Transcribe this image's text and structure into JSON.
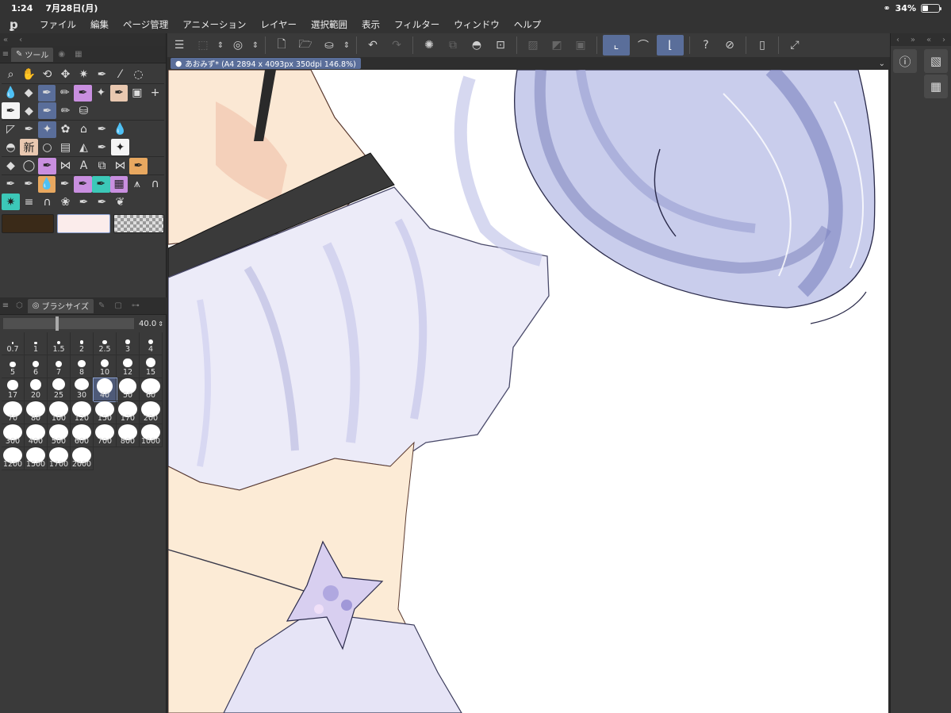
{
  "status_bar": {
    "time": "1:24",
    "date": "7月28日(月)",
    "battery": "34%",
    "battery_level": 0.34
  },
  "menubar": {
    "items": [
      "ファイル",
      "編集",
      "ページ管理",
      "アニメーション",
      "レイヤー",
      "選択範囲",
      "表示",
      "フィルター",
      "ウィンドウ",
      "ヘルプ"
    ]
  },
  "tool_panel": {
    "tab_label": "ツール"
  },
  "brush_panel": {
    "tab_label": "ブラシサイズ",
    "current_value": "40.0",
    "slider_level": 0.4,
    "selected": "40",
    "sizes": [
      "0.7",
      "1",
      "1.5",
      "2",
      "2.5",
      "3",
      "4",
      "5",
      "6",
      "7",
      "8",
      "10",
      "12",
      "15",
      "17",
      "20",
      "25",
      "30",
      "40",
      "50",
      "60",
      "70",
      "80",
      "100",
      "120",
      "150",
      "170",
      "200",
      "300",
      "400",
      "500",
      "600",
      "700",
      "800",
      "1000",
      "1200",
      "1500",
      "1700",
      "2000"
    ]
  },
  "colors": {
    "main": "#3a2a18",
    "sub": "#fbeceb",
    "accent": "#5a6e9a"
  },
  "canvas_tab": {
    "title": "あおみず* (A4 2894 x 4093px 350dpi 146.8%)"
  }
}
